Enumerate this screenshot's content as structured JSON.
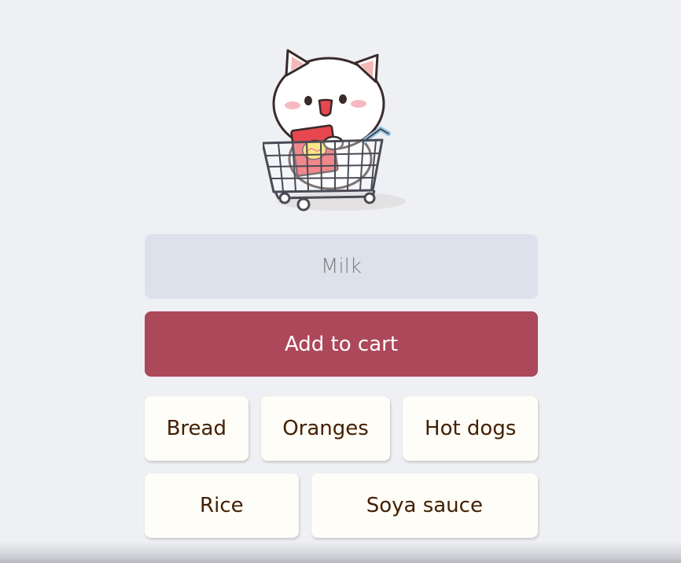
{
  "mascot": {
    "icon": "cat-in-shopping-cart-icon",
    "colors": {
      "cat_body": "#ffffff",
      "outline": "#3a2a2a",
      "ear_inner": "#f6b7b7",
      "cheek": "#f7b9c0",
      "snack_bag": "#e8474f",
      "snack_label": "#f6d84a",
      "cart_wire": "#4b4b55",
      "cart_handle": "#8fc3e6"
    }
  },
  "input": {
    "value": "",
    "placeholder": "Milk"
  },
  "add_button": {
    "label": "Add to cart"
  },
  "shopping_list": {
    "items": [
      "Bread",
      "Oranges",
      "Hot dogs",
      "Rice",
      "Soya sauce"
    ]
  },
  "colors": {
    "background": "#eef0f4",
    "input_bg": "#dce1eb",
    "button_bg": "#ac485a",
    "button_text": "#fdfdfd",
    "item_bg": "#fffdf8",
    "item_text": "#432000"
  }
}
